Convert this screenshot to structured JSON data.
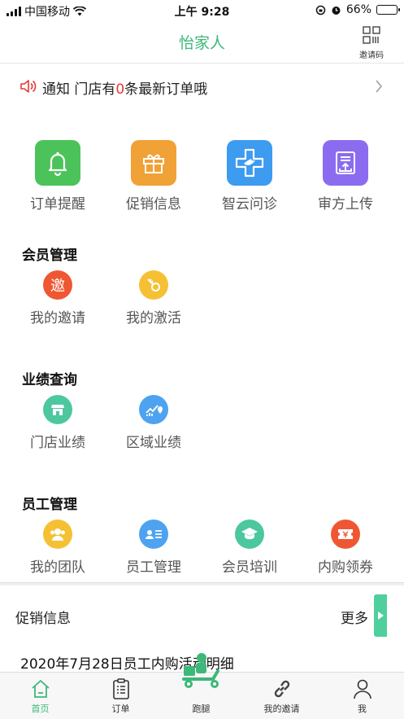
{
  "status_bar": {
    "carrier": "中国移动",
    "time": "上午 9:28",
    "battery": "66%",
    "battery_level": 0.66
  },
  "header": {
    "title": "怡家人",
    "invite_code_label": "邀请码"
  },
  "notice": {
    "prefix": "通知 门店有",
    "count": "0",
    "suffix": "条最新订单哦"
  },
  "top_grid": [
    {
      "label": "订单提醒",
      "icon": "bell-icon",
      "color": "#4cc35a"
    },
    {
      "label": "促销信息",
      "icon": "gift-icon",
      "color": "#f0a236"
    },
    {
      "label": "智云问诊",
      "icon": "consult-icon",
      "color": "#3d9bf0"
    },
    {
      "label": "审方上传",
      "icon": "upload-icon",
      "color": "#8b6cf0"
    }
  ],
  "member": {
    "title": "会员管理",
    "items": [
      {
        "label": "我的邀请",
        "icon": "invite-icon",
        "glyph": "邀",
        "color": "#ef5733"
      },
      {
        "label": "我的激活",
        "icon": "key-icon",
        "color": "#f5c033"
      }
    ]
  },
  "performance": {
    "title": "业绩查询",
    "items": [
      {
        "label": "门店业绩",
        "icon": "store-icon",
        "color": "#4cc7a0"
      },
      {
        "label": "区域业绩",
        "icon": "region-chart-icon",
        "color": "#4da3ef"
      }
    ]
  },
  "staff": {
    "title": "员工管理",
    "items": [
      {
        "label": "我的团队",
        "icon": "team-icon",
        "color": "#f5c033"
      },
      {
        "label": "员工管理",
        "icon": "staff-card-icon",
        "color": "#4da3ef"
      },
      {
        "label": "会员培训",
        "icon": "graduation-icon",
        "color": "#4cc7a0"
      },
      {
        "label": "内购领券",
        "icon": "coupon-icon",
        "color": "#ef5733"
      }
    ]
  },
  "promo": {
    "title": "促销信息",
    "more": "更多",
    "first_item": "2020年7月28日员工内购活动明细"
  },
  "tabbar": [
    {
      "label": "首页",
      "icon": "home-icon",
      "active": true
    },
    {
      "label": "订单",
      "icon": "clipboard-icon",
      "active": false
    },
    {
      "label": "跑腿",
      "icon": "scooter-icon",
      "active": false
    },
    {
      "label": "我的邀请",
      "icon": "link-icon",
      "active": false
    },
    {
      "label": "我",
      "icon": "person-icon",
      "active": false
    }
  ]
}
